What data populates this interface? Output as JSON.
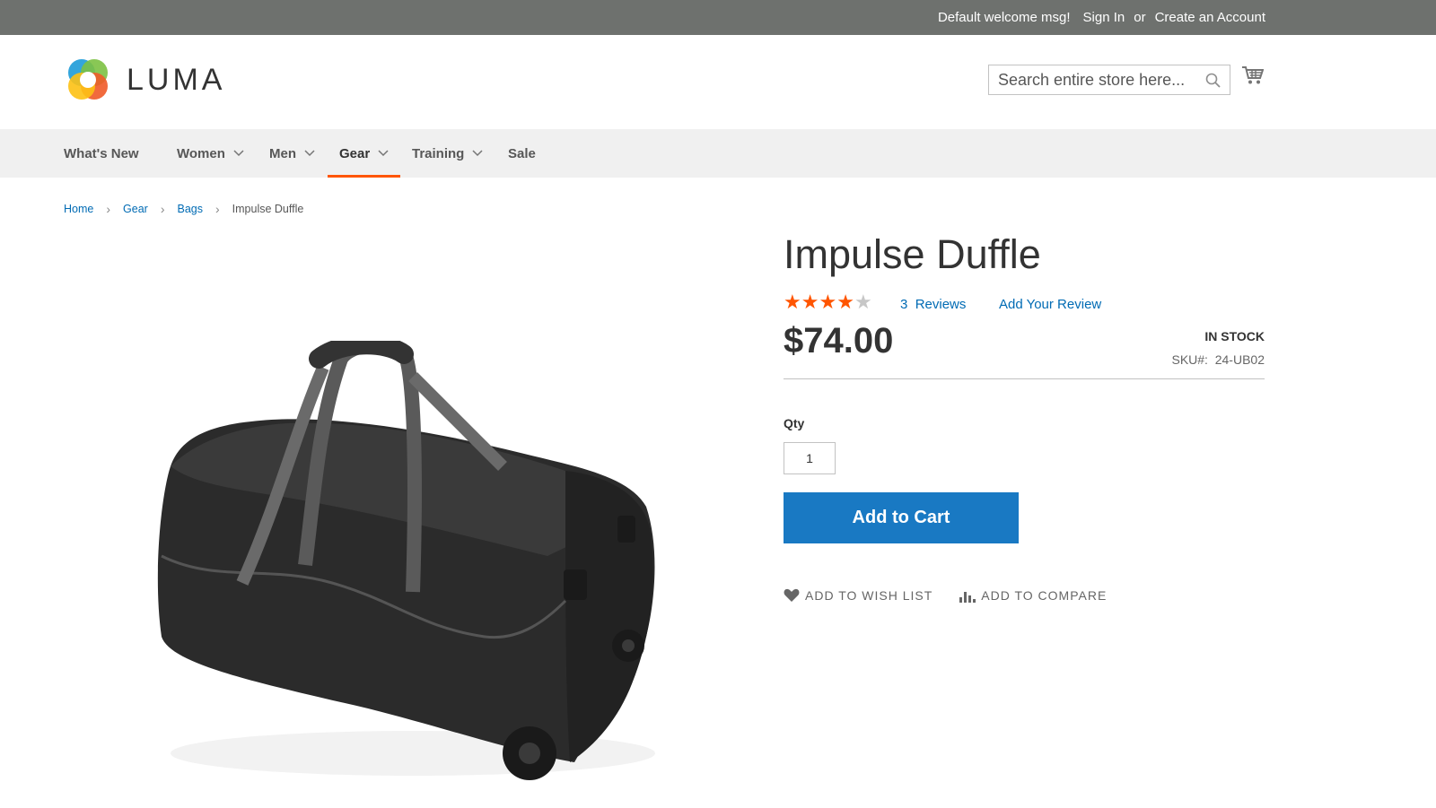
{
  "topbar": {
    "welcome": "Default welcome msg!",
    "sign_in": "Sign In",
    "or": "or",
    "create_account": "Create an Account"
  },
  "header": {
    "logo_text": "LUMA",
    "search_placeholder": "Search entire store here..."
  },
  "nav": {
    "items": [
      {
        "label": "What's New",
        "dropdown": false
      },
      {
        "label": "Women",
        "dropdown": true
      },
      {
        "label": "Men",
        "dropdown": true
      },
      {
        "label": "Gear",
        "dropdown": true,
        "active": true
      },
      {
        "label": "Training",
        "dropdown": true
      },
      {
        "label": "Sale",
        "dropdown": false
      }
    ]
  },
  "breadcrumb": {
    "home": "Home",
    "gear": "Gear",
    "bags": "Bags",
    "current": "Impulse Duffle"
  },
  "product": {
    "title": "Impulse Duffle",
    "rating": 4,
    "rating_max": 5,
    "reviews_count": "3",
    "reviews_label": "Reviews",
    "add_review": "Add Your Review",
    "price": "$74.00",
    "stock": "IN STOCK",
    "sku_label": "SKU#:",
    "sku": "24-UB02",
    "qty_label": "Qty",
    "qty_value": "1",
    "add_to_cart": "Add to Cart",
    "wishlist": "ADD TO WISH LIST",
    "compare": "ADD TO COMPARE"
  },
  "colors": {
    "topbar": "#6e716e",
    "link": "#006bb4",
    "accent": "#ff5501",
    "button": "#1979c3",
    "star_on": "#ff5501",
    "star_off": "#c7c7c7"
  },
  "icons": [
    "search-icon",
    "cart-icon",
    "chevron-down-icon",
    "heart-icon",
    "compare-icon",
    "star-icon"
  ]
}
